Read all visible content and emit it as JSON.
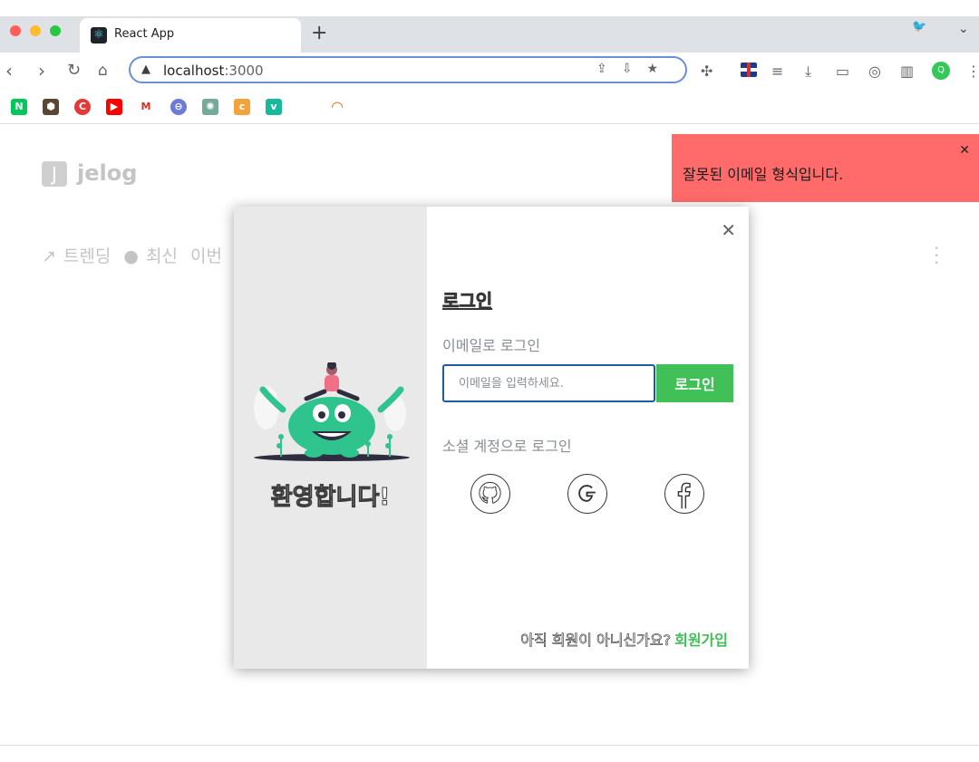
{
  "browser": {
    "tab_title": "React App",
    "new_tab": "+",
    "url_host": "localhost",
    "url_port": ":3000"
  },
  "page": {
    "logo_badge": "J",
    "logo_text": "jelog",
    "nav": {
      "trending": "트렌딩",
      "latest": "최신",
      "period": "이번"
    }
  },
  "toast": {
    "message": "잘못된 이메일 형식입니다.",
    "close": "✕",
    "color": "#ff6b6b"
  },
  "modal": {
    "welcome": "환영합니다!",
    "title": "로그인",
    "email_label": "이메일로 로그인",
    "email_placeholder": "이메일을 입력하세요.",
    "login_button": "로그인",
    "social_label": "소셜 계정으로 로그인",
    "social": [
      "github-icon",
      "google-icon",
      "facebook-icon"
    ],
    "signup_question": "아직 회원이 아니신가요?",
    "signup_link": "회원가입",
    "accent_color": "#40c057"
  }
}
